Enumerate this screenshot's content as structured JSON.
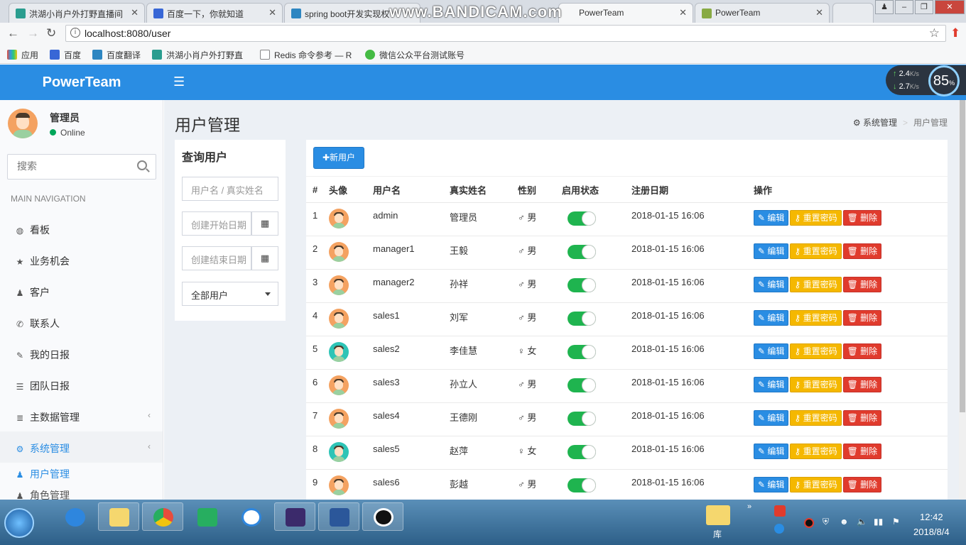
{
  "browser": {
    "tabs": [
      {
        "title": "洪湖小肖户外打野直播间",
        "icon_color": "#2a9d8f"
      },
      {
        "title": "百度一下，你就知道",
        "icon_color": "#3867d6"
      },
      {
        "title": "spring boot开发实现权",
        "icon_color": "#2e86c1"
      },
      {
        "title": "PowerTeam",
        "icon_color": "#88aa44"
      },
      {
        "title": "PowerTeam",
        "icon_color": "#88aa44"
      }
    ],
    "watermark": "www.BANDICAM.com",
    "url": "localhost:8080/user",
    "bookmarks": [
      {
        "label": "应用",
        "icon_color": "#e74c3c"
      },
      {
        "label": "百度",
        "icon_color": "#3867d6"
      },
      {
        "label": "百度翻译",
        "icon_color": "#2e86c1"
      },
      {
        "label": "洪湖小肖户外打野直",
        "icon_color": "#2a9d8f"
      },
      {
        "label": "Redis 命令参考 — R",
        "icon_color": "#ffffff"
      },
      {
        "label": "微信公众平台测试账号",
        "icon_color": "#44bb44"
      }
    ]
  },
  "netmon": {
    "up": "2.4",
    "down": "2.7",
    "unit": "K/s",
    "percent": "85",
    "percent_unit": "%"
  },
  "app": {
    "brand": "PowerTeam",
    "user": {
      "name": "管理员",
      "status": "Online"
    },
    "search_placeholder": "搜索",
    "nav_header": "MAIN NAVIGATION",
    "nav": [
      {
        "label": "看板",
        "icon": "dashboard-icon",
        "glyph": "◍"
      },
      {
        "label": "业务机会",
        "icon": "star-icon",
        "glyph": "★"
      },
      {
        "label": "客户",
        "icon": "user-icon",
        "glyph": "♟"
      },
      {
        "label": "联系人",
        "icon": "phone-icon",
        "glyph": "✆"
      },
      {
        "label": "我的日报",
        "icon": "pin-icon",
        "glyph": "✎"
      },
      {
        "label": "团队日报",
        "icon": "list-icon",
        "glyph": "☰"
      },
      {
        "label": "主数据管理",
        "icon": "database-icon",
        "glyph": "≣"
      },
      {
        "label": "系统管理",
        "icon": "gears-icon",
        "glyph": "⚙"
      }
    ],
    "subnav": [
      {
        "label": "用户管理",
        "icon": "user-icon",
        "glyph": "♟"
      },
      {
        "label": "角色管理",
        "icon": "users-icon",
        "glyph": "♟"
      }
    ],
    "page_title": "用户管理",
    "breadcrumb": {
      "parent": "系统管理",
      "current": "用户管理",
      "sep": ">"
    },
    "query": {
      "title": "查询用户",
      "name_placeholder": "用户名 / 真实姓名",
      "start_placeholder": "创建开始日期",
      "end_placeholder": "创建结束日期",
      "filter_value": "全部用户"
    },
    "add_button": "新用户",
    "table": {
      "headers": [
        "#",
        "头像",
        "用户名",
        "真实姓名",
        "性别",
        "启用状态",
        "注册日期",
        "操作"
      ],
      "actions": {
        "edit": "编辑",
        "reset": "重置密码",
        "delete": "删除"
      },
      "rows": [
        {
          "no": "1",
          "avatar": "m",
          "username": "admin",
          "realname": "管理员",
          "gender": "♂ 男",
          "enabled": true,
          "date": "2018-01-15 16:06"
        },
        {
          "no": "2",
          "avatar": "m",
          "username": "manager1",
          "realname": "王毅",
          "gender": "♂ 男",
          "enabled": true,
          "date": "2018-01-15 16:06"
        },
        {
          "no": "3",
          "avatar": "m",
          "username": "manager2",
          "realname": "孙祥",
          "gender": "♂ 男",
          "enabled": true,
          "date": "2018-01-15 16:06"
        },
        {
          "no": "4",
          "avatar": "m",
          "username": "sales1",
          "realname": "刘军",
          "gender": "♂ 男",
          "enabled": true,
          "date": "2018-01-15 16:06"
        },
        {
          "no": "5",
          "avatar": "f",
          "username": "sales2",
          "realname": "李佳慧",
          "gender": "♀ 女",
          "enabled": true,
          "date": "2018-01-15 16:06"
        },
        {
          "no": "6",
          "avatar": "m",
          "username": "sales3",
          "realname": "孙立人",
          "gender": "♂ 男",
          "enabled": true,
          "date": "2018-01-15 16:06"
        },
        {
          "no": "7",
          "avatar": "m",
          "username": "sales4",
          "realname": "王德刚",
          "gender": "♂ 男",
          "enabled": true,
          "date": "2018-01-15 16:06"
        },
        {
          "no": "8",
          "avatar": "f",
          "username": "sales5",
          "realname": "赵萍",
          "gender": "♀ 女",
          "enabled": true,
          "date": "2018-01-15 16:06"
        },
        {
          "no": "9",
          "avatar": "m",
          "username": "sales6",
          "realname": "彭越",
          "gender": "♂ 男",
          "enabled": true,
          "date": "2018-01-15 16:06"
        }
      ]
    }
  },
  "taskbar": {
    "pinned": [
      "ie-icon",
      "explorer-icon",
      "chrome-icon",
      "green-app-icon",
      "baidu-netdisk-icon",
      "java-ee-ide-icon",
      "word-icon",
      "bandicam-icon"
    ],
    "library_label": "库",
    "time": "12:42",
    "date": "2018/8/4"
  }
}
